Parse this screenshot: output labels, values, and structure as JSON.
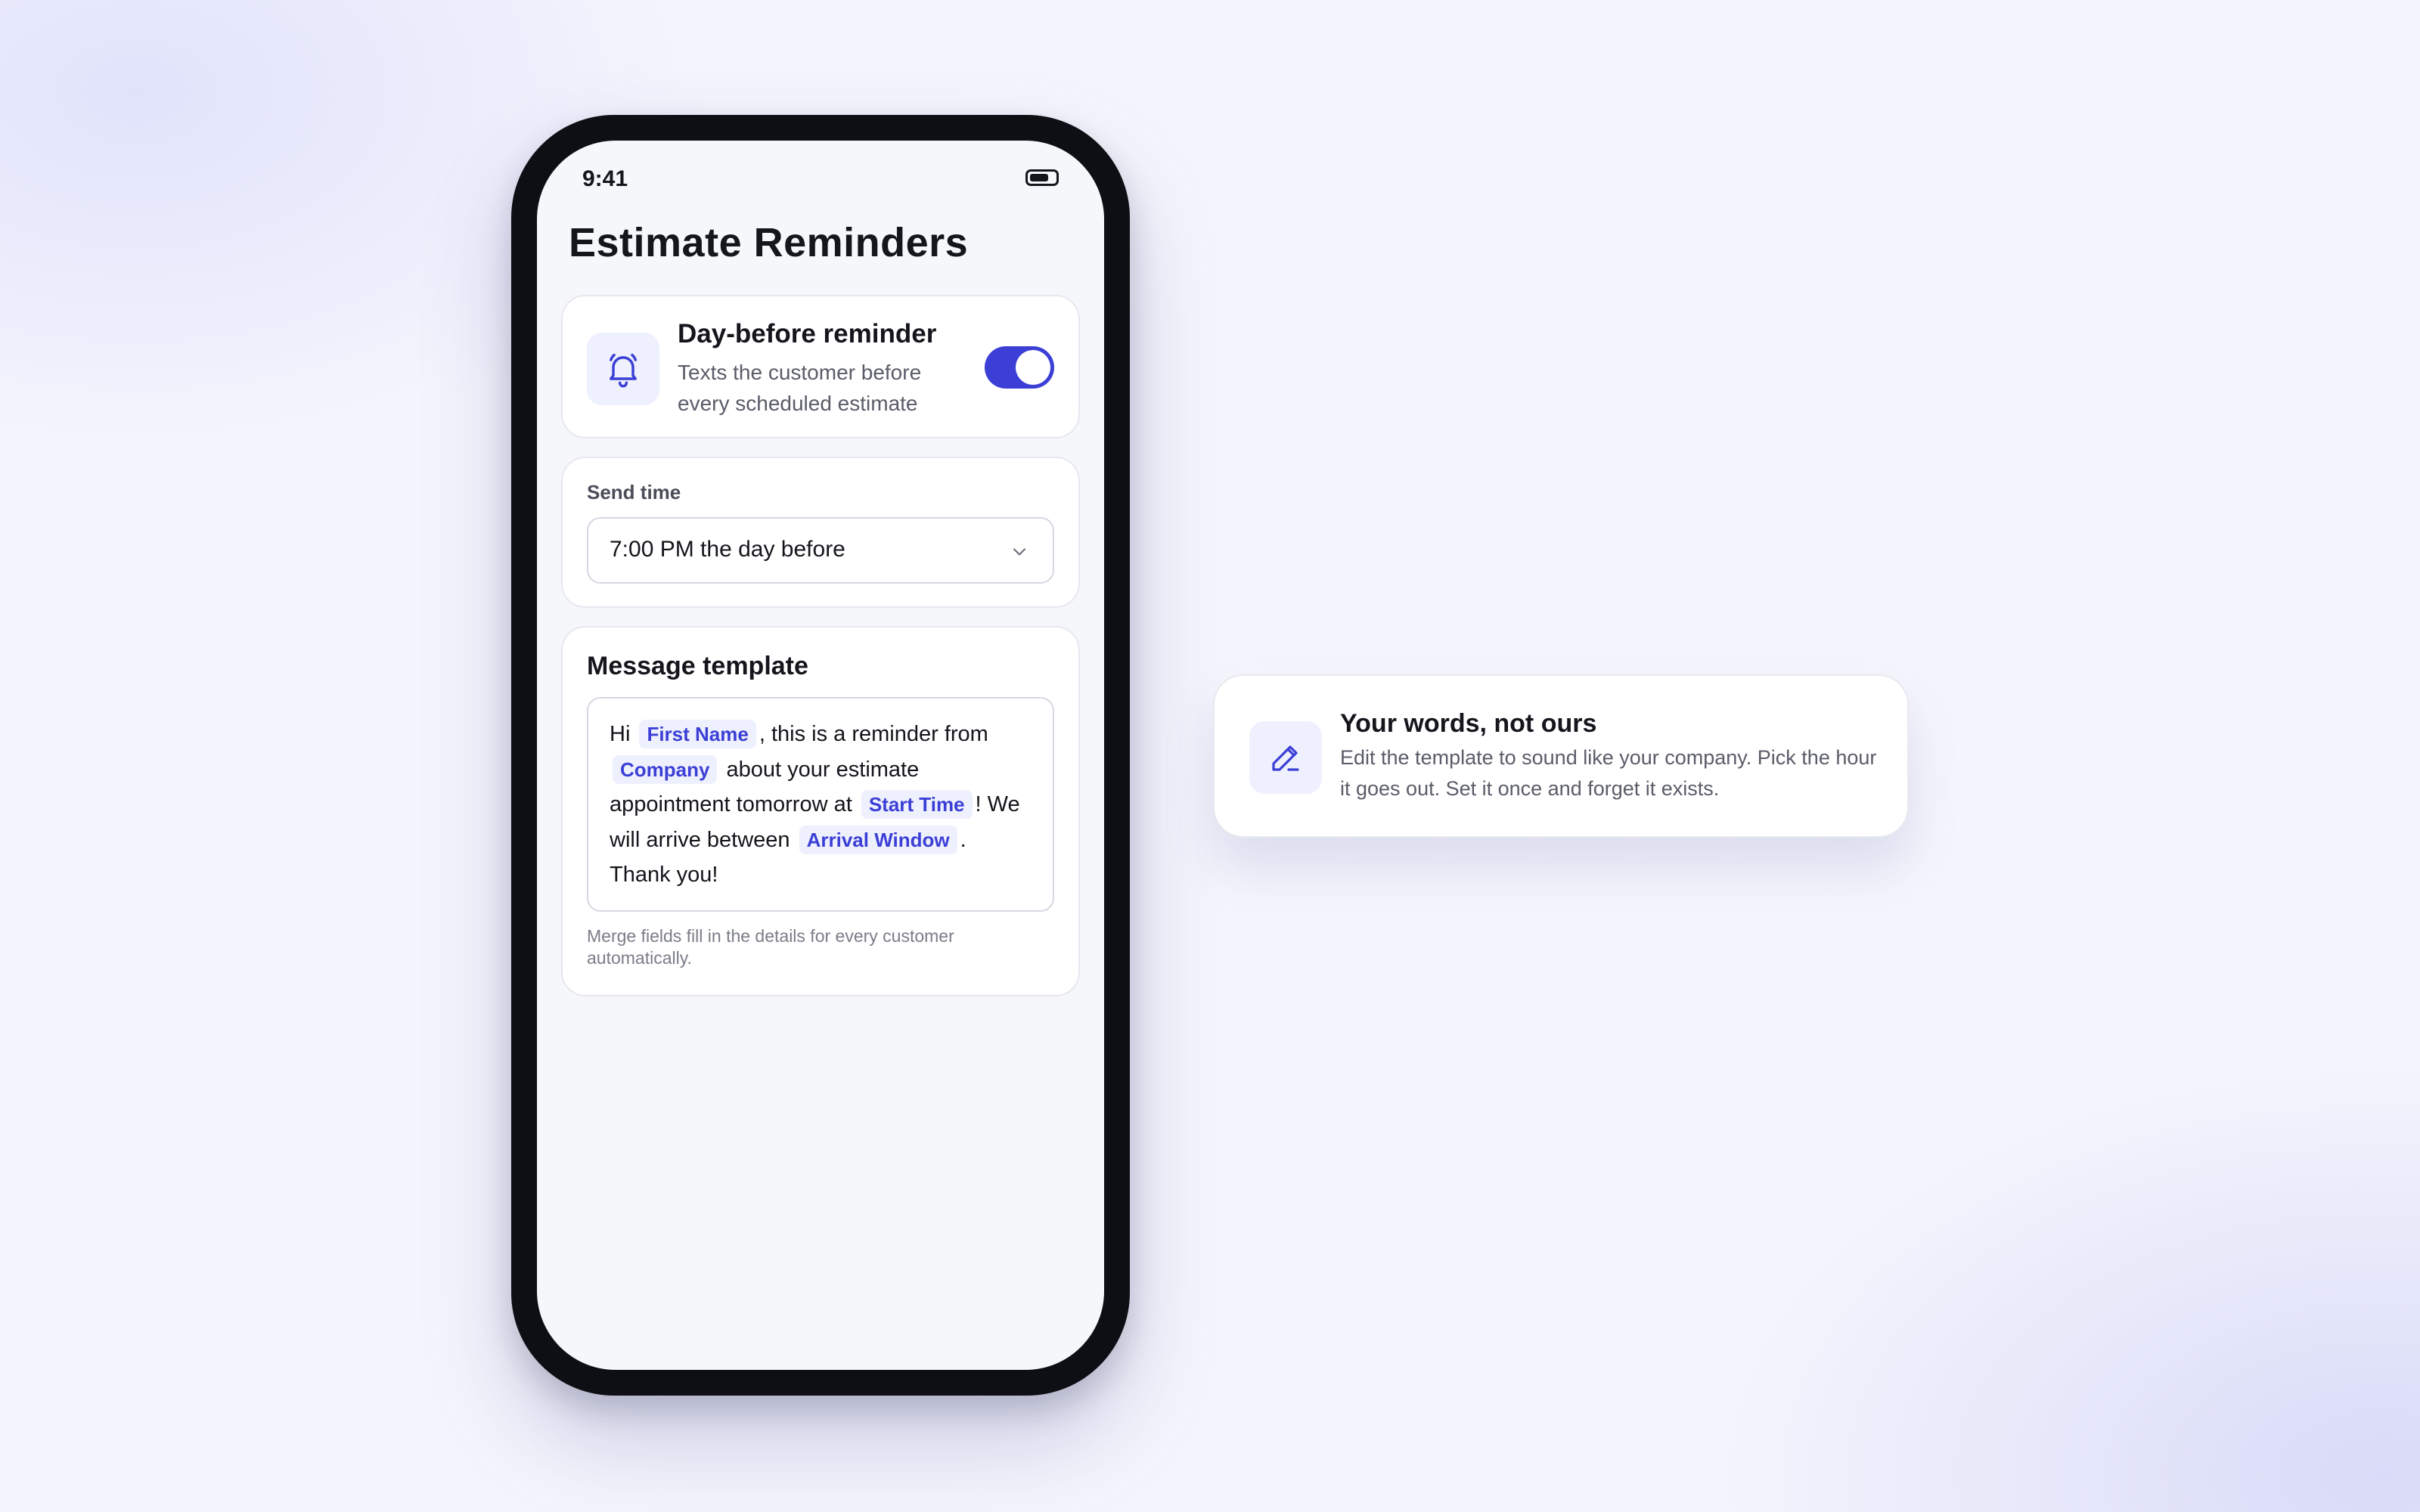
{
  "status_bar": {
    "time": "9:41"
  },
  "page": {
    "title": "Estimate Reminders"
  },
  "reminder_card": {
    "title": "Day-before reminder",
    "description": "Texts the customer before every scheduled estimate",
    "toggle_on": true,
    "icon": "bell-icon"
  },
  "send_time_card": {
    "label": "Send time",
    "selected_value": "7:00 PM the day before",
    "icon": "chevron-down-icon"
  },
  "template_card": {
    "title": "Message template",
    "segments": {
      "s1": "Hi",
      "field_first_name": "First Name",
      "s2": ", this is a reminder from",
      "field_company": "Company",
      "s3": "about your estimate appointment tomorrow at",
      "field_start_time": "Start Time",
      "s4": "! We will arrive between",
      "field_arrival_window": "Arrival Window",
      "s5": ". Thank you!"
    },
    "hint": "Merge fields fill in the details for every customer automatically."
  },
  "callout": {
    "title": "Your words, not ours",
    "description": "Edit the template to sound like your company. Pick the hour it goes out. Set it once and forget it exists.",
    "icon": "pencil-icon"
  },
  "colors": {
    "accent": "#3b3fd6",
    "chip_background": "#eef0fd",
    "text_primary": "#15161c",
    "text_secondary": "#5a5c68"
  }
}
